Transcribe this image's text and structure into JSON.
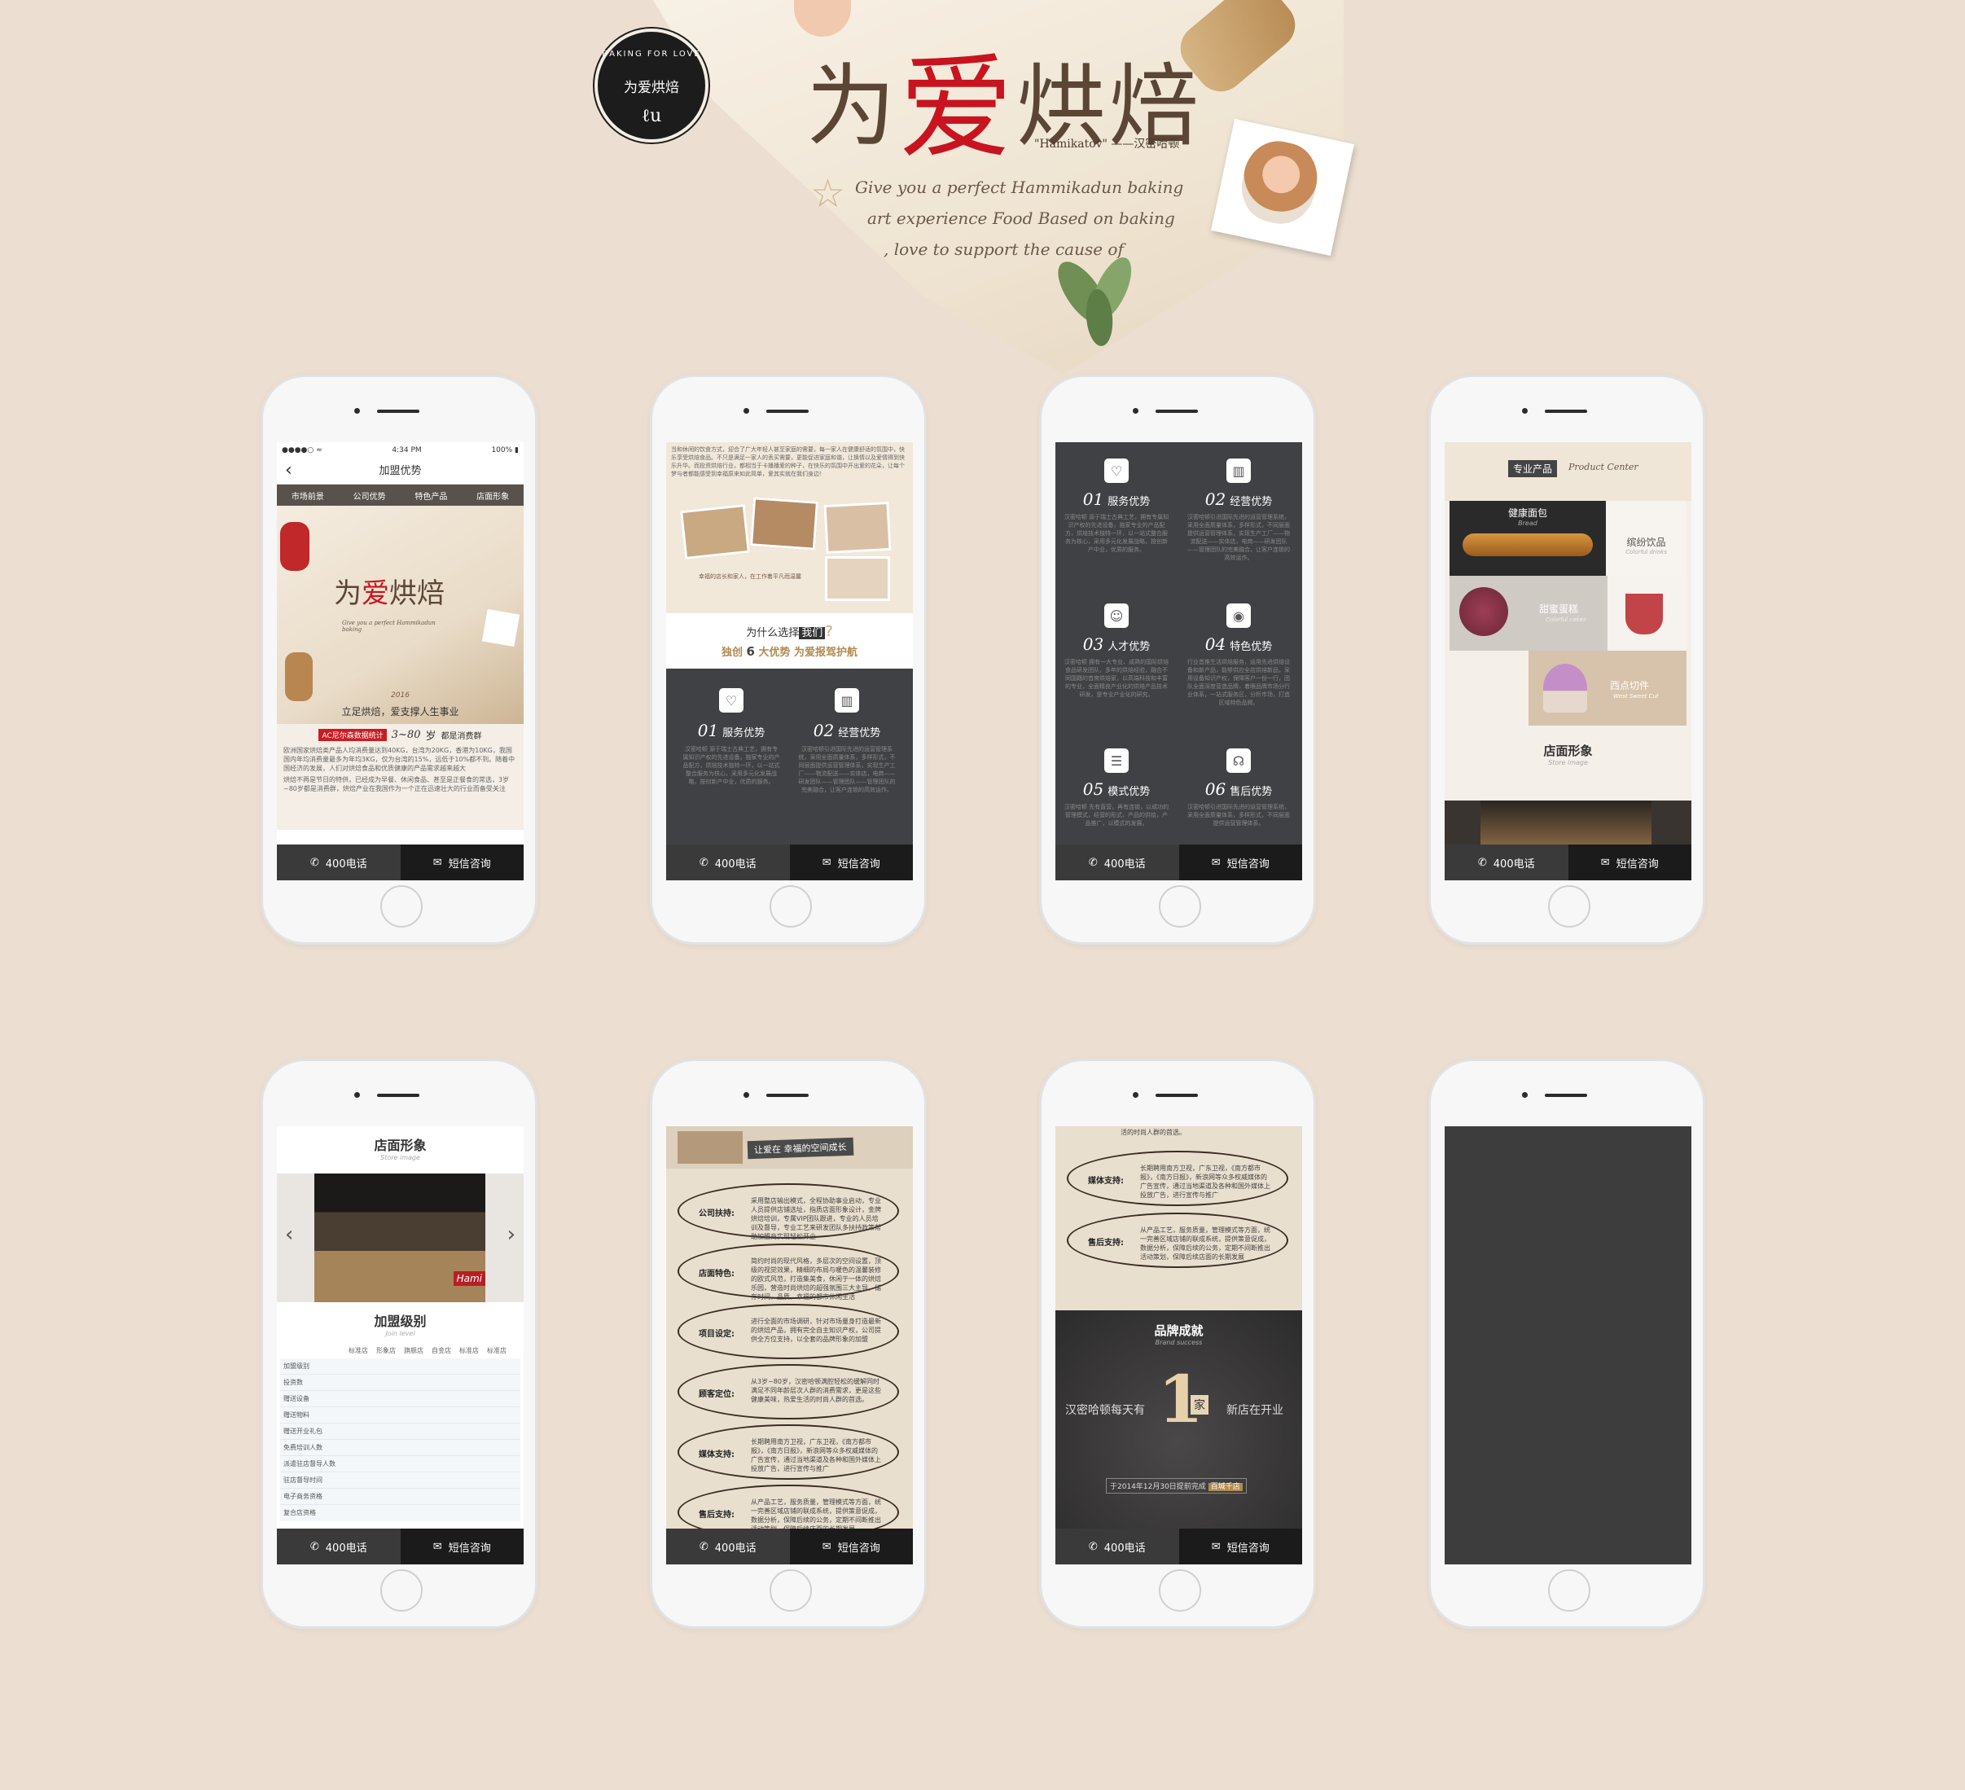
{
  "hero": {
    "badge_top": "BAKING FOR LOVE",
    "badge_title": "为爱烘焙",
    "badge_mark": "ℓu",
    "title_a": "为",
    "title_b": "爱",
    "title_c": "烘焙",
    "sub": "\"Hamikatov\" ——汉密哈顿",
    "script1": "Give you a perfect Hammikadun baking",
    "script2": "art experience Food Based on baking",
    "script3": ", love to support the cause of"
  },
  "footer": {
    "call": "400电话",
    "sms": "短信咨询",
    "call_icon": "phone-icon",
    "sms_icon": "mail-icon"
  },
  "p1": {
    "status_time": "4:34 PM",
    "battery": "100%",
    "back": "‹",
    "title": "加盟优势",
    "tabs": [
      "市场前景",
      "公司优势",
      "特色产品",
      "店面形象"
    ],
    "year": "2016",
    "slogan": "立足烘焙，爱支撑人生事业",
    "badge": "AC尼尔森数据统计",
    "range": "3~80",
    "range_unit": "岁",
    "range_tail": "都是消费群",
    "para1": "欧洲国家烘焙类产品人均消费量达到40KG，台湾为20KG，香港为10KG，我国国内年均消费量最多为年均3KG，仅为台湾的15%，远低于10%都不到。随着中国经济的发展，人们对烘焙食品和优质健康的产品需求越来越大",
    "para2": "烘焙不再是节日的特供，已经成为早餐、休闲食品、甚至是正餐食的常选，3岁~80岁都是消费群，烘焙产业在我国作为一个正在迅速壮大的行业而备受关注"
  },
  "p2": {
    "intro": "当和休闲的饮食方式，迎合了广大年轻人甚至家庭的需要，每一家人在健康舒适的氛围中，快乐享受烘焙食品。不只是满足一家人的丢买需要，更能促进家庭和谐，让换情以及爱情得到快乐升华。而投资烘焙行业，都相当于卡播播爱的种子，在快乐的氛围中开出爱的花朵，让每个梦与者都能感受到幸福原来如此简单，爱其实就在我们身边！",
    "photo_note": "幸福的店长和家人，在工作着平凡而温馨",
    "q_pre": "为什么选择",
    "q_hi": "我们",
    "q_mark": "?",
    "a1": "独创",
    "a2": "6",
    "a3": "大优势 为爱报驾护航",
    "items": [
      {
        "icon": "heart-icon",
        "num": "01",
        "label": "服务优势",
        "text": "汉密哈顿 源于瑞士古典工艺，拥有专属知识产权的先进设备，独家专业的产品配方，烘焙技术独特一环，以一站式整合服务为核心，采用多元化发展战略，按创新产中业，优质的服务。"
      },
      {
        "icon": "chart-icon",
        "num": "02",
        "label": "经营优势",
        "text": "汉密哈顿引进国际先进的运营管理系统，采用全面质量体系，多样形式，不同层面提供运营管理体系，实现生产工厂——物流配送——实体店，电商——研发团队——管理团队——管理团队的完美融合，让客户连锁的高效运作。"
      }
    ]
  },
  "p3": {
    "items": [
      {
        "icon": "heart-icon",
        "num": "01",
        "label": "服务优势",
        "text": "汉密哈顿 源于瑞士古典工艺，拥有专属知识产权的先进设备，独家专业的产品配方，烘焙技术独特一环，以一站式整合服务为核心，采用多元化发展战略，按创新产中业，优质的服务。"
      },
      {
        "icon": "chart-icon",
        "num": "02",
        "label": "经营优势",
        "text": "汉密哈顿引进国际先进的运营管理系统，采用全面质量体系，多样形式，不同层面提供运营管理体系，实现生产工厂——物流配送——实体店，电商——研发团队——管理团队的完美融合，让客户连锁的高效运作。"
      },
      {
        "icon": "person-icon",
        "num": "03",
        "label": "人才优势",
        "text": "汉密哈顿 拥有一大专业、成熟的国际烘焙食品研发团队，多年的烘焙经验，融合不同国籍的首席烘焙家，以高端科技和丰富的专业，全面精良产业化的烘焙产品技术研发，是专业产业化的研究。"
      },
      {
        "icon": "eye-icon",
        "num": "04",
        "label": "特色优势",
        "text": "行业首推生活烘焙服务，运用先进烘焙设备和新产品，能够供应全店烘焙新品，采用设备知识产权，保障客户一份一行，团队全面深度营造品牌，着眼品牌市场分行业体系，一站式服务区，分析市场，打造区域特色品牌。"
      },
      {
        "icon": "list-icon",
        "num": "05",
        "label": "模式优势",
        "text": "汉密哈顿 先有直营，再有连锁，以成功的管理模式，经营的形式，产品的供给，产品推广，以模式的发展。"
      },
      {
        "icon": "headset-icon",
        "num": "06",
        "label": "售后优势",
        "text": "汉密哈顿引进国际先进的运营管理系统，采用全面质量体系，多样形式，不同层面提供运营管理体系。"
      }
    ]
  },
  "p4": {
    "title": "专业产品",
    "title_script": "Product Center",
    "bread": "健康面包",
    "bread_s": "Bread",
    "drink": "缤纷饮品",
    "drink_s": "Colorful drinks",
    "cake": "甜蜜蛋糕",
    "cake_s": "Colorful cakes",
    "west": "西点切件",
    "west_s": "West Sweet Cut",
    "store": "店面形象",
    "store_s": "Store image"
  },
  "p5": {
    "store": "店面形象",
    "store_s": "Store image",
    "prev": "‹",
    "next": "›",
    "sign": "Hami",
    "level": "加盟级别",
    "level_s": "Join level",
    "cols": [
      "标准店",
      "形象店",
      "旗舰店",
      "自金店",
      "标准店",
      "标准店"
    ],
    "rows": [
      "加盟级别",
      "投资数",
      "赠送设备",
      "赠送物料",
      "赠送开业礼包",
      "免费培训人数",
      "派遣驻店督导人数",
      "驻店督导时间",
      "电子商务资格",
      "复合店资格"
    ]
  },
  "p6": {
    "banner": "让爱在 幸福的空间成长",
    "items": [
      {
        "k": "公司扶持:",
        "v": "采用整店输出模式，全程协助事业启动，专业人员提供店铺选址，指质店面形象设计，金牌烘焙培训，专属VIP团队跟进，专业的人员培训及督导，专业工艺来研发团队多扶持政策帮助加盟商实现轻松开业"
      },
      {
        "k": "店面特色:",
        "v": "简约时尚的现代风格，多层次的空间设置，顶级的视觉效果，精细的布局与暖色的温馨装修的欧式风范，打造集美食，休闲于一体的烘焙乐园，营造时尚烘焙的超强氛围三大主导，储存时间，品质，幸福的都市休闲生活"
      },
      {
        "k": "项目设定:",
        "v": "进行全面的市场调研，针对市场量身打造最新的烘焙产品，拥有完全自主知识产权，公司提供全方位支持，以全套的品牌形象的加盟"
      },
      {
        "k": "顾客定位:",
        "v": "从3岁~80岁，汉密哈顿满腔轻松的缓解同时满足不同年龄层次人群的消费需求，更是这些健康美味，热爱生活的时尚人群的首选。"
      },
      {
        "k": "媒体支持:",
        "v": "长期聘用南方卫视，广东卫视，《南方都市报》，《南方日报》，新浪网等众多权威媒体的广告宣传，通过当地渠道及各种和国外媒体上投放广告，进行宣传与推广"
      },
      {
        "k": "售后支持:",
        "v": "从产品工艺，服务质量，管理模式等方面，统一完善区域店铺的联成系统，提供策意促成，数据分析，保障后续的公务，定期不间断推出活动策划，保障后续店面的长期发展"
      }
    ]
  },
  "p7": {
    "top_note": "活的时尚人群的首选。",
    "items": [
      {
        "k": "媒体支持:",
        "v": "长期聘用南方卫视，广东卫视，《南方都市报》，《南方日报》，新浪网等众多权威媒体的广告宣传，通过当地渠道及各种和国外媒体上投放广告，进行宣传与推广"
      },
      {
        "k": "售后支持:",
        "v": "从产品工艺，服务质量，管理模式等方面，统一完善区域店铺的联成系统，提供策意促成，数据分析，保障后续的公务，定期不间断推出活动策划，保障后续店面的长期发展"
      }
    ],
    "brand": "品牌成就",
    "brand_s": "Brand success",
    "left": "汉密哈顿每天有",
    "big": "1",
    "unit": "家",
    "right": "新店在开业",
    "note": "于2014年12月30日提前完成",
    "note_hi": "百城千店"
  }
}
